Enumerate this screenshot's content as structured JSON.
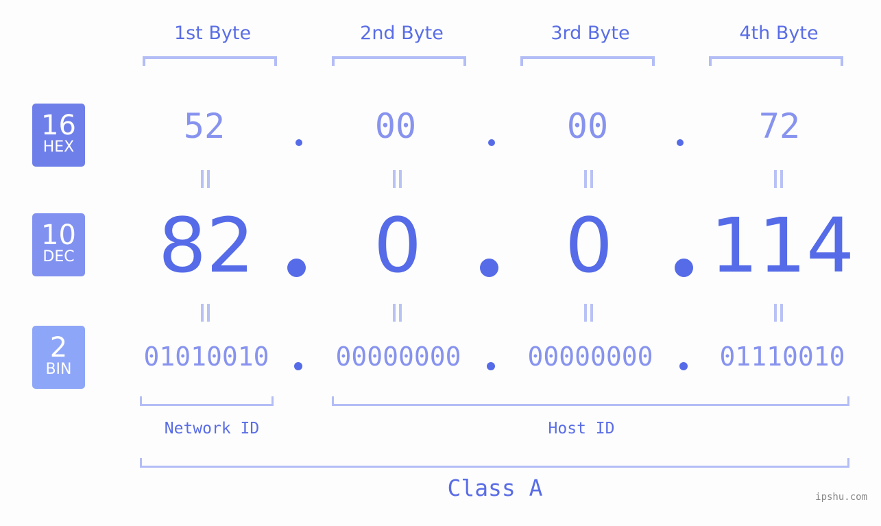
{
  "byte_headers": [
    "1st Byte",
    "2nd Byte",
    "3rd Byte",
    "4th Byte"
  ],
  "rows": {
    "hex": {
      "base": "16",
      "label": "HEX",
      "values": [
        "52",
        "00",
        "00",
        "72"
      ],
      "badge_color": "#6f7fe9"
    },
    "dec": {
      "base": "10",
      "label": "DEC",
      "values": [
        "82",
        "0",
        "0",
        "114"
      ],
      "badge_color": "#8191f0"
    },
    "bin": {
      "base": "2",
      "label": "BIN",
      "values": [
        "01010010",
        "00000000",
        "00000000",
        "01110010"
      ],
      "badge_color": "#8ea6f8"
    }
  },
  "separator": ".",
  "segments": {
    "network": "Network ID",
    "host": "Host ID"
  },
  "ip_class": "Class A",
  "watermark": "ipshu.com",
  "colors": {
    "accent": "#566be8",
    "muted": "#8793ee",
    "bracket": "#b3bdf6",
    "background": "#fcfdfc"
  }
}
